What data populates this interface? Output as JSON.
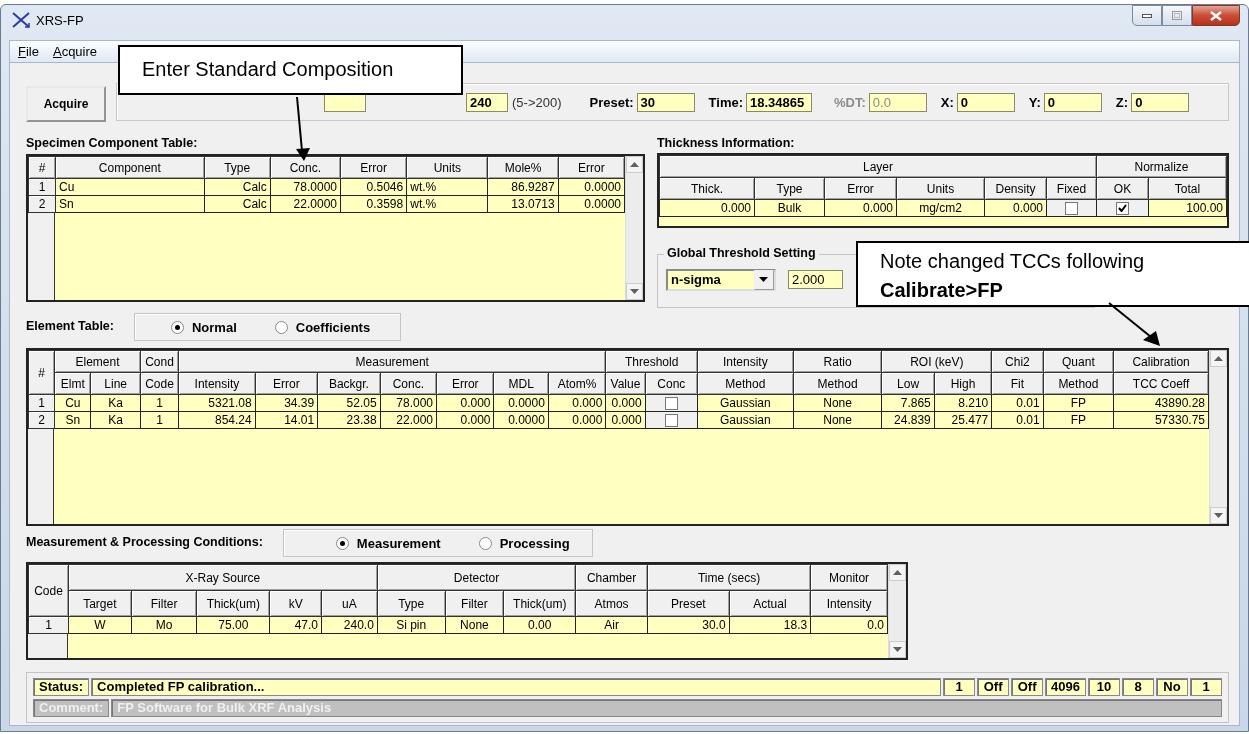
{
  "window": {
    "title": "XRS-FP"
  },
  "menu": [
    {
      "label": "File"
    },
    {
      "label": "Acquire"
    }
  ],
  "toolbar": {
    "acquire_button": "Acquire",
    "items": [
      {
        "kind": "blank"
      },
      {
        "kind": "field",
        "value": "240"
      },
      {
        "kind": "note",
        "text": "(5->200)"
      },
      {
        "kind": "field",
        "label": "Preset:",
        "value": "30",
        "disabled": false
      },
      {
        "kind": "field",
        "label": "Time:",
        "value": "18.34865",
        "disabled": false
      },
      {
        "kind": "field",
        "label": "%DT:",
        "value": "0.0",
        "disabled": true
      },
      {
        "kind": "field",
        "label": "X:",
        "value": "0",
        "disabled": false
      },
      {
        "kind": "field",
        "label": "Y:",
        "value": "0",
        "disabled": false
      },
      {
        "kind": "field",
        "label": "Z:",
        "value": "0",
        "disabled": false
      }
    ]
  },
  "specimen_table": {
    "title": "Specimen Component Table:",
    "number_header": "#",
    "columns": [
      "Component",
      "Type",
      "Conc.",
      "Error",
      "Units",
      "Mole%",
      "Error"
    ],
    "rows": [
      {
        "num": "1",
        "cells": [
          "Cu",
          "Calc",
          "78.0000",
          "0.5046",
          "wt.%",
          "86.9287",
          "0.0000"
        ]
      },
      {
        "num": "2",
        "cells": [
          "Sn",
          "Calc",
          "22.0000",
          "0.3598",
          "wt.%",
          "13.0713",
          "0.0000"
        ]
      }
    ]
  },
  "thickness": {
    "title": "Thickness Information:",
    "groups": [
      {
        "label": "Layer",
        "columns": [
          "Thick.",
          "Type",
          "Error",
          "Units",
          "Density",
          "Fixed"
        ]
      },
      {
        "label": "Normalize",
        "columns": [
          "OK",
          "Total"
        ]
      }
    ],
    "rows": [
      {
        "cells": [
          "0.000",
          "Bulk",
          "0.000",
          "mg/cm2",
          "0.000",
          {
            "kind": "checkbox",
            "checked": false
          },
          {
            "kind": "checkbox",
            "checked": true
          },
          "100.00"
        ]
      }
    ]
  },
  "global_threshold": {
    "title": "Global Threshold Setting",
    "method": "n-sigma",
    "value": "2.000"
  },
  "element_table": {
    "title": "Element Table:",
    "options": [
      {
        "label": "Normal",
        "selected": true
      },
      {
        "label": "Coefficients",
        "selected": false
      }
    ],
    "groups": [
      {
        "label": "#"
      },
      {
        "label": "Element",
        "columns": [
          "Elmt",
          "Line"
        ]
      },
      {
        "label": "Cond",
        "columns": [
          "Code"
        ]
      },
      {
        "label": "Measurement",
        "columns": [
          "Intensity",
          "Error",
          "Backgr.",
          "Conc.",
          "Error",
          "MDL",
          "Atom%"
        ]
      },
      {
        "label": "Threshold",
        "columns": [
          "Value",
          "Conc"
        ]
      },
      {
        "label": "Intensity",
        "columns": [
          "Method"
        ]
      },
      {
        "label": "Ratio",
        "columns": [
          "Method"
        ]
      },
      {
        "label": "ROI (keV)",
        "columns": [
          "Low",
          "High"
        ]
      },
      {
        "label": "Chi2",
        "columns": [
          "Fit"
        ]
      },
      {
        "label": "Quant",
        "columns": [
          "Method"
        ]
      },
      {
        "label": "Calibration",
        "columns": [
          "TCC Coeff"
        ]
      }
    ],
    "rows": [
      {
        "num": "1",
        "cells": [
          "Cu",
          "Ka",
          "1",
          "5321.08",
          "34.39",
          "52.05",
          "78.000",
          "0.000",
          "0.0000",
          "0.000",
          "0.000",
          {
            "kind": "checkbox",
            "checked": false
          },
          "Gaussian",
          "None",
          "7.865",
          "8.210",
          "0.01",
          "FP",
          "43890.28"
        ]
      },
      {
        "num": "2",
        "cells": [
          "Sn",
          "Ka",
          "1",
          "854.24",
          "14.01",
          "23.38",
          "22.000",
          "0.000",
          "0.0000",
          "0.000",
          "0.000",
          {
            "kind": "checkbox",
            "checked": false
          },
          "Gaussian",
          "None",
          "24.839",
          "25.477",
          "0.01",
          "FP",
          "57330.75"
        ]
      }
    ]
  },
  "conditions": {
    "title": "Measurement & Processing Conditions:",
    "options": [
      {
        "label": "Measurement",
        "selected": true
      },
      {
        "label": "Processing",
        "selected": false
      }
    ],
    "groups": [
      {
        "label": "Code"
      },
      {
        "label": "X-Ray Source",
        "columns": [
          "Target",
          "Filter",
          "Thick(um)",
          "kV",
          "uA"
        ]
      },
      {
        "label": "Detector",
        "columns": [
          "Type",
          "Filter",
          "Thick(um)"
        ]
      },
      {
        "label": "Chamber",
        "columns": [
          "Atmos"
        ]
      },
      {
        "label": "Time (secs)",
        "columns": [
          "Preset",
          "Actual"
        ]
      },
      {
        "label": "Monitor",
        "columns": [
          "Intensity"
        ]
      }
    ],
    "rows": [
      {
        "num": "1",
        "cells": [
          "W",
          "Mo",
          "75.00",
          "47.0",
          "240.0",
          "Si pin",
          "None",
          "0.00",
          "Air",
          "30.0",
          "18.3",
          "0.0"
        ]
      }
    ]
  },
  "status_bar": {
    "status_label": "Status:",
    "status": "Completed FP calibration...",
    "indicators": [
      "1",
      "Off",
      "Off",
      "4096",
      "10",
      "8",
      "No",
      "1"
    ],
    "comment_label": "Comment:",
    "comment": "FP Software for Bulk XRF Analysis"
  },
  "callouts": [
    {
      "text": "Enter Standard Composition"
    },
    {
      "text": "Note changed TCCs following **Calibrate>FP**"
    }
  ]
}
